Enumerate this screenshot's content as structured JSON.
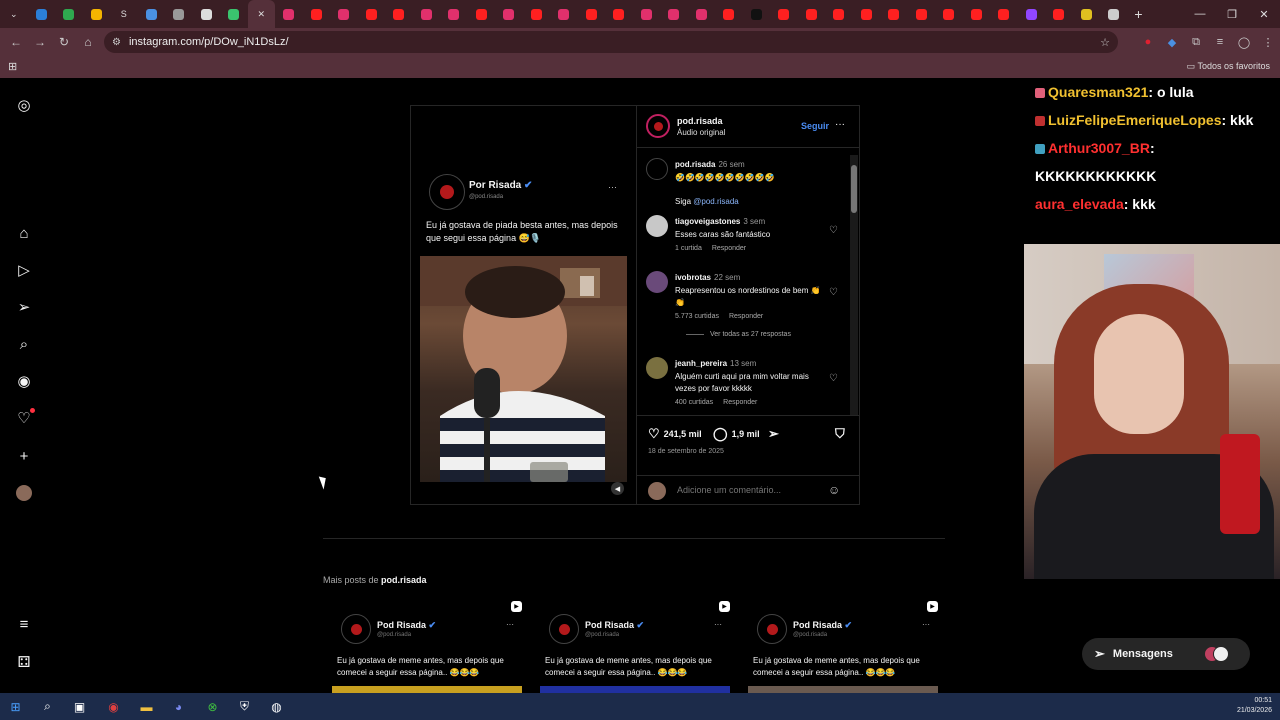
{
  "browser": {
    "url": "instagram.com/p/DOw_iN1DsLz/",
    "bookmarks_folder": "Todos os favoritos",
    "tabs": [
      {
        "icon": "dropdown-icon",
        "color": "#3a1e24",
        "glyph": "⌄"
      },
      {
        "icon": "gem-icon",
        "color": "#2b7fd8"
      },
      {
        "icon": "drive-icon",
        "color": "#2fa84f"
      },
      {
        "icon": "drive-icon",
        "color": "#f4b400"
      },
      {
        "icon": "s-icon",
        "color": "#222222",
        "glyph": "S"
      },
      {
        "icon": "cloud-icon",
        "color": "#4a90e2"
      },
      {
        "icon": "web-icon",
        "color": "#999999"
      },
      {
        "icon": "chatgpt-icon",
        "color": "#dddddd"
      },
      {
        "icon": "arrows-icon",
        "color": "#3ac46e"
      },
      {
        "icon": "close-icon",
        "color": "#55303a",
        "glyph": "✕"
      },
      {
        "icon": "instagram-icon",
        "color": "#e1306c"
      },
      {
        "icon": "youtube-icon",
        "color": "#ff2020"
      },
      {
        "icon": "instagram-icon",
        "color": "#e1306c"
      },
      {
        "icon": "youtube-icon",
        "color": "#ff2020"
      },
      {
        "icon": "youtube-icon",
        "color": "#ff2020"
      },
      {
        "icon": "instagram-icon",
        "color": "#e1306c"
      },
      {
        "icon": "instagram-icon",
        "color": "#e1306c"
      },
      {
        "icon": "youtube-icon",
        "color": "#ff2020"
      },
      {
        "icon": "instagram-icon",
        "color": "#e1306c"
      },
      {
        "icon": "youtube-icon",
        "color": "#ff2020"
      },
      {
        "icon": "instagram-icon",
        "color": "#e1306c"
      },
      {
        "icon": "youtube-icon",
        "color": "#ff2020"
      },
      {
        "icon": "youtube-icon",
        "color": "#ff2020"
      },
      {
        "icon": "instagram-icon",
        "color": "#e1306c"
      },
      {
        "icon": "instagram-icon",
        "color": "#e1306c"
      },
      {
        "icon": "instagram-icon",
        "color": "#e1306c"
      },
      {
        "icon": "youtube-icon",
        "color": "#ff2020"
      },
      {
        "icon": "tiktok-icon",
        "color": "#111111"
      },
      {
        "icon": "youtube-icon",
        "color": "#ff2020"
      },
      {
        "icon": "youtube-icon",
        "color": "#ff2020"
      },
      {
        "icon": "youtube-icon",
        "color": "#ff2020"
      },
      {
        "icon": "youtube-icon",
        "color": "#ff2020"
      },
      {
        "icon": "youtube-icon",
        "color": "#ff2020"
      },
      {
        "icon": "youtube-icon",
        "color": "#ff2020"
      },
      {
        "icon": "youtube-icon",
        "color": "#ff2020"
      },
      {
        "icon": "youtube-icon",
        "color": "#ff2020"
      },
      {
        "icon": "youtube-icon",
        "color": "#ff2020"
      },
      {
        "icon": "twitch-icon",
        "color": "#9146ff"
      },
      {
        "icon": "youtube-icon",
        "color": "#ff2020"
      },
      {
        "icon": "smile-icon",
        "color": "#e0c020"
      },
      {
        "icon": "chrome-icon",
        "color": "#cccccc"
      }
    ]
  },
  "sidebar": {
    "items": [
      {
        "name": "instagram-logo-icon",
        "glyph": "◎"
      },
      {
        "name": "home-icon",
        "glyph": "⌂"
      },
      {
        "name": "reels-icon",
        "glyph": "▷"
      },
      {
        "name": "messages-icon",
        "glyph": "➢"
      },
      {
        "name": "search-icon",
        "glyph": "⌕"
      },
      {
        "name": "explore-icon",
        "glyph": "◉"
      },
      {
        "name": "notifications-icon",
        "glyph": "♡"
      },
      {
        "name": "create-icon",
        "glyph": "+"
      },
      {
        "name": "menu-icon",
        "glyph": "≡"
      },
      {
        "name": "more-icon",
        "glyph": "⚃"
      }
    ]
  },
  "post": {
    "owner": "pod.risada",
    "audio": "Áudio original",
    "follow": "Seguir",
    "more": "···",
    "media": {
      "name": "Por Risada",
      "handle": "@pod.risada",
      "text": "Eu já gostava de piada besta antes, mas depois que segui essa página 😅🎙️",
      "dots": "···"
    },
    "caption": {
      "user": "pod.risada",
      "time": "26 sem",
      "emojis": "🤣🤣🤣🤣🤣🤣🤣🤣🤣🤣",
      "follow_text": "Siga",
      "mention": "@pod.risada"
    },
    "comments": [
      {
        "user": "tiagoveigastones",
        "time": "3 sem",
        "text": "Esses caras são fantástico",
        "likes": "1 curtida",
        "reply": "Responder",
        "avatar": "#c8c8c8"
      },
      {
        "user": "ivobrotas",
        "time": "22 sem",
        "text": "Reapresentou os nordestinos de bem 👏👏",
        "likes": "5.773 curtidas",
        "reply": "Responder",
        "avatar": "#6a4a7a",
        "replies": "Ver todas as 27 respostas"
      },
      {
        "user": "jeanh_pereira",
        "time": "13 sem",
        "text": "Alguém curti aqui pra mim voltar mais vezes por favor kkkkk",
        "likes": "400 curtidas",
        "reply": "Responder",
        "avatar": "#7a7040"
      }
    ],
    "likes": "241,5 mil",
    "comments_count": "1,9 mil",
    "date": "18 de setembro de 2025",
    "add_comment_placeholder": "Adicione um comentário..."
  },
  "more_posts": {
    "label": "Mais posts de",
    "user": "pod.risada",
    "cards": [
      {
        "name": "Pod Risada",
        "handle": "@pod.risada",
        "text": "Eu já gostava de meme antes, mas depois que comecei a seguir essa página.. 😂😂😂",
        "dots": "···",
        "strip": "#c8a020"
      },
      {
        "name": "Pod Risada",
        "handle": "@pod.risada",
        "text": "Eu já gostava de meme antes, mas depois que comecei a seguir essa página.. 😂😂😂",
        "dots": "···",
        "strip": "#2030a0"
      },
      {
        "name": "Pod Risada",
        "handle": "@pod.risada",
        "text": "Eu já gostava de meme antes, mas depois que comecei a seguir essa página.. 😂😂😂",
        "dots": "···",
        "strip": "#6a5a50"
      }
    ]
  },
  "chat": [
    {
      "user": "Quaresman321",
      "text": ": o lula",
      "color": "#f0c030",
      "badge": "#e0607a"
    },
    {
      "user": "LuizFelipeEmeriqueLopes",
      "text": ": kkk",
      "color": "#f0c030",
      "badge": "#c03030"
    },
    {
      "user": "Arthur3007_BR",
      "text": ":",
      "color": "#ff3030",
      "badge": "#40a0c0"
    },
    {
      "user": "",
      "text": "KKKKKKKKKKKK",
      "color": "#ffffff",
      "badge": ""
    },
    {
      "user": "aura_elevada",
      "text": ": kkk",
      "color": "#ff3030",
      "badge": ""
    }
  ],
  "messages_button": "Mensagens",
  "taskbar": {
    "time": "00:51",
    "date": "21/03/2026",
    "icons": [
      {
        "name": "windows-start-icon",
        "glyph": "⊞",
        "color": "#4aa0ff"
      },
      {
        "name": "search-icon",
        "glyph": "⌕",
        "color": "#ffffff"
      },
      {
        "name": "task-view-icon",
        "glyph": "▣",
        "color": "#ffffff"
      },
      {
        "name": "chrome-icon",
        "glyph": "◉",
        "color": "#e04040"
      },
      {
        "name": "file-explorer-icon",
        "glyph": "▬",
        "color": "#f0c040"
      },
      {
        "name": "discord-icon",
        "glyph": "◕",
        "color": "#7a8af0"
      },
      {
        "name": "xbox-icon",
        "glyph": "⊗",
        "color": "#40c040"
      },
      {
        "name": "shield-icon",
        "glyph": "⛨",
        "color": "#ffffff"
      },
      {
        "name": "obs-icon",
        "glyph": "◍",
        "color": "#ffffff"
      }
    ]
  }
}
